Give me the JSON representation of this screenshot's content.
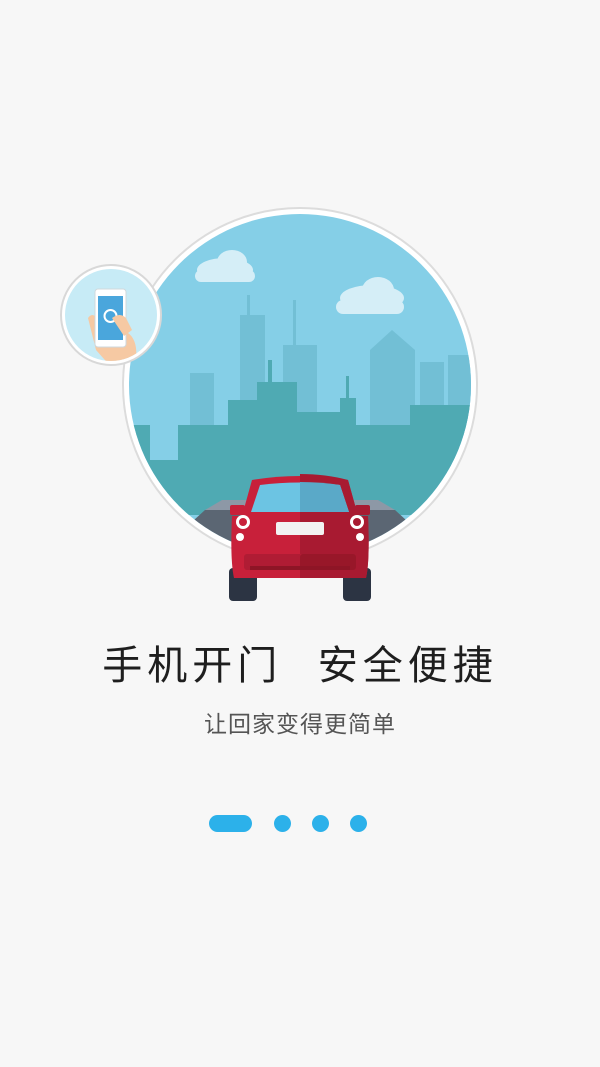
{
  "headline": "手机开门  安全便捷",
  "subtitle": "让回家变得更简单",
  "pager": {
    "total": 4,
    "active_index": 0,
    "active_color": "#2cb1ea",
    "inactive_color": "#2cb1ea"
  },
  "illustration": {
    "scene": "city-skyline-with-red-car",
    "badge": "phone-in-hand-icon",
    "sky_color": "#84cfe7",
    "car_color": "#c8203a"
  }
}
